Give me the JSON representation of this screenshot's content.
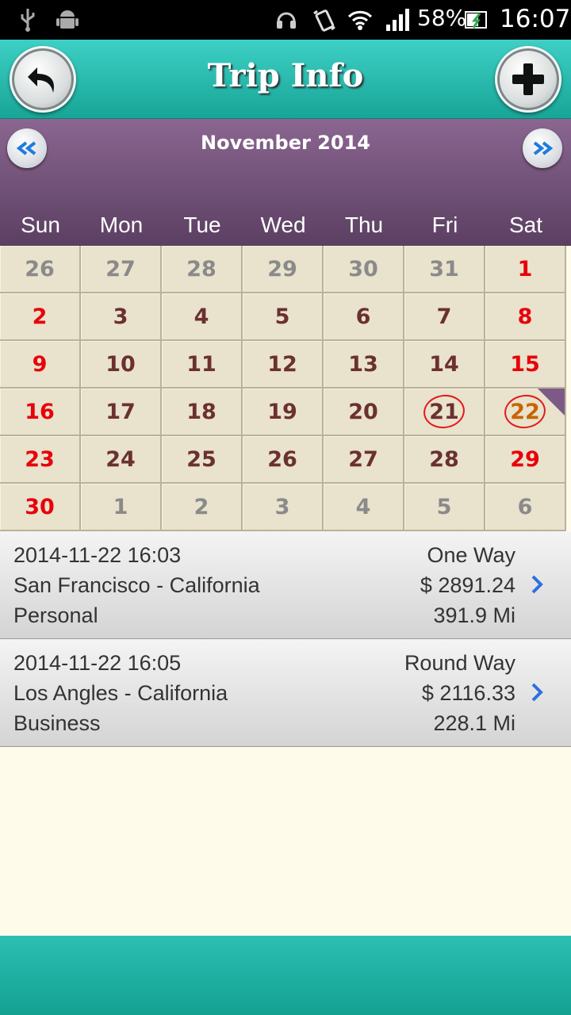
{
  "status_bar": {
    "battery": "58%",
    "time": "16:07",
    "icons": [
      "usb-icon",
      "android-icon",
      "headset-icon",
      "vibrate-icon",
      "wifi-icon",
      "signal-icon",
      "battery-icon"
    ]
  },
  "header": {
    "title": "Trip Info",
    "back_icon": "back-arrow-icon",
    "add_icon": "plus-icon"
  },
  "calendar": {
    "month_label": "November 2014",
    "prev_icon": "double-chevron-left-icon",
    "next_icon": "double-chevron-right-icon",
    "weekdays": [
      "Sun",
      "Mon",
      "Tue",
      "Wed",
      "Thu",
      "Fri",
      "Sat"
    ],
    "weeks": [
      [
        "26",
        "27",
        "28",
        "29",
        "30",
        "31",
        "1"
      ],
      [
        "2",
        "3",
        "4",
        "5",
        "6",
        "7",
        "8"
      ],
      [
        "9",
        "10",
        "11",
        "12",
        "13",
        "14",
        "15"
      ],
      [
        "16",
        "17",
        "18",
        "19",
        "20",
        "21",
        "22"
      ],
      [
        "23",
        "24",
        "25",
        "26",
        "27",
        "28",
        "29"
      ],
      [
        "30",
        "1",
        "2",
        "3",
        "4",
        "5",
        "6"
      ]
    ],
    "outside_month": [
      [
        1,
        1,
        1,
        1,
        1,
        1,
        0
      ],
      [
        0,
        0,
        0,
        0,
        0,
        0,
        0
      ],
      [
        0,
        0,
        0,
        0,
        0,
        0,
        0
      ],
      [
        0,
        0,
        0,
        0,
        0,
        0,
        0
      ],
      [
        0,
        0,
        0,
        0,
        0,
        0,
        0
      ],
      [
        0,
        1,
        1,
        1,
        1,
        1,
        1
      ]
    ],
    "circled_days": [
      "21",
      "22"
    ],
    "selected_day": "22",
    "colors": {
      "weekday_text": "#6b3030",
      "weekend_text": "#e8000b",
      "outside_text": "#8a8a8a",
      "selected_text": "#c86400",
      "circle": "#e21a1a"
    }
  },
  "trips": [
    {
      "datetime": "2014-11-22 16:03",
      "location": "San Francisco -  California",
      "category": "Personal",
      "trip_type": "One Way",
      "amount": "$  2891.24",
      "distance": "391.9  Mi"
    },
    {
      "datetime": "2014-11-22 16:05",
      "location": "Los Angles -  California",
      "category": "Business",
      "trip_type": "Round Way",
      "amount": "$  2116.33",
      "distance": "228.1  Mi"
    }
  ],
  "accent_color": "#2f6fe0"
}
